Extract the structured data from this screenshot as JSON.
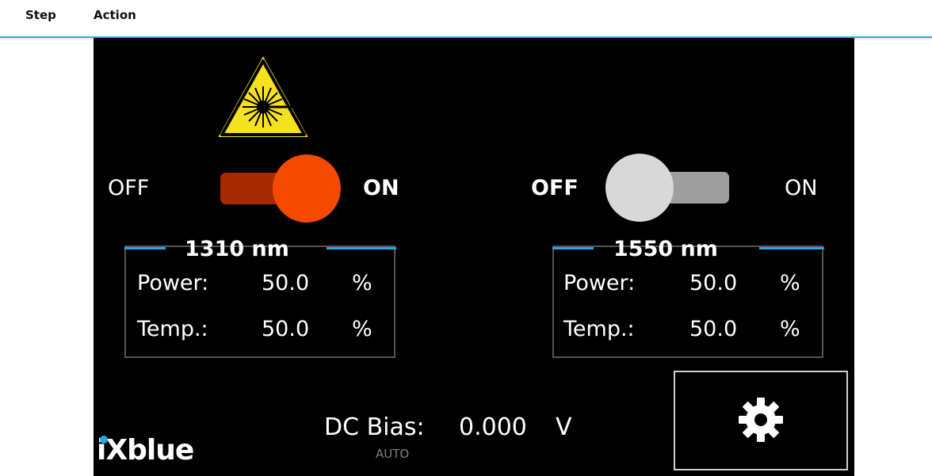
{
  "table": {
    "header": {
      "step_label": "Step",
      "action_label": "Action"
    }
  },
  "device": {
    "laser_warning_icon": "laser-warning-icon",
    "channels": [
      {
        "off_label": "OFF",
        "on_label": "ON",
        "state": "on",
        "switch_color": "#f44a00",
        "title": "1310 nm",
        "power_label": "Power:",
        "power_value": "50.0",
        "power_unit": "%",
        "temp_label": "Temp.:",
        "temp_value": "50.0",
        "temp_unit": "%"
      },
      {
        "off_label": "OFF",
        "on_label": "ON",
        "state": "off",
        "switch_color": "#d8d8d8",
        "title": "1550 nm",
        "power_label": "Power:",
        "power_value": "50.0",
        "power_unit": "%",
        "temp_label": "Temp.:",
        "temp_value": "50.0",
        "temp_unit": "%"
      }
    ],
    "dc_bias": {
      "label": "DC Bias:",
      "value": "0.000",
      "unit": "V",
      "mode": "AUTO"
    },
    "settings_icon": "gear-icon",
    "brand": {
      "logo_text": "iXblue",
      "accent": "#2aa8e0"
    }
  }
}
